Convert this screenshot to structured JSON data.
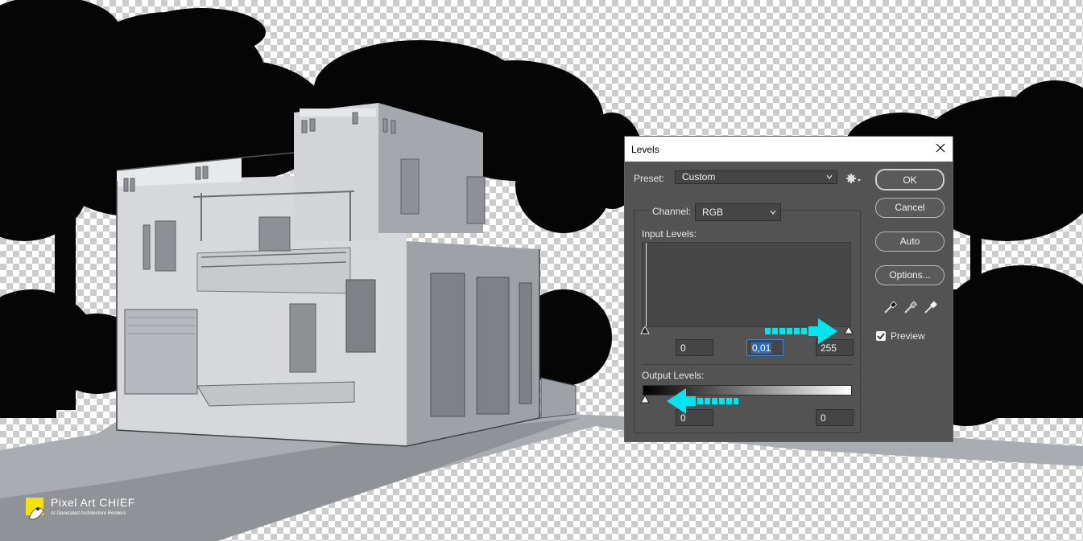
{
  "dialog": {
    "title": "Levels",
    "preset_label": "Preset:",
    "preset_value": "Custom",
    "channel_label": "Channel:",
    "channel_value": "RGB",
    "input_levels_label": "Input Levels:",
    "input_black": "0",
    "input_gamma": "0,01",
    "input_white": "255",
    "output_levels_label": "Output Levels:",
    "output_black": "0",
    "output_white": "0",
    "buttons": {
      "ok": "OK",
      "cancel": "Cancel",
      "auto": "Auto",
      "options": "Options..."
    },
    "preview_label": "Preview",
    "preview_checked": true
  },
  "watermark": {
    "brand": "Pixel Art CHIEF",
    "tagline": "AI Generated Architecture Renders"
  },
  "colors": {
    "accent_arrow": "#00e5f0",
    "dialog_bg": "#535353",
    "dialog_border": "#1e6fb8"
  },
  "icons": [
    "gear-icon",
    "close-icon",
    "chevron-down-icon",
    "eyedropper-black-icon",
    "eyedropper-gray-icon",
    "eyedropper-white-icon",
    "checkbox-checked-icon"
  ]
}
